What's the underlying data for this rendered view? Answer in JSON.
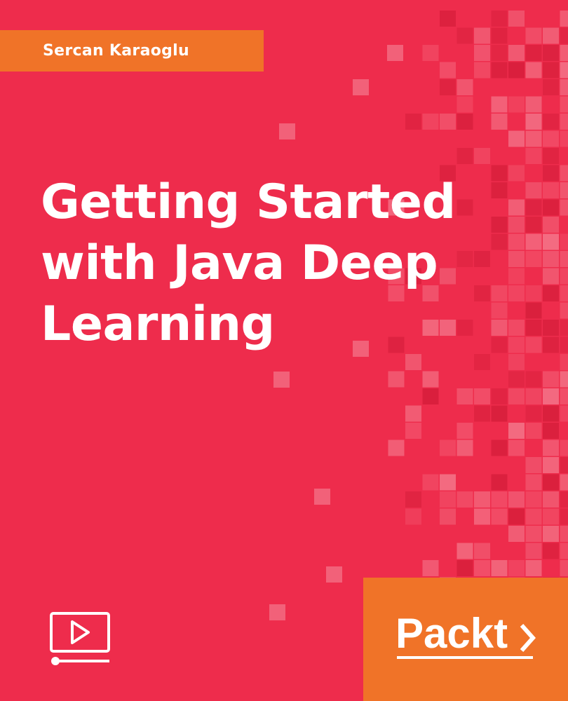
{
  "cover": {
    "author": "Sercan Karaoglu",
    "title_lines": [
      "Getting Started",
      "with Java Deep",
      "Learning"
    ],
    "publisher": "Packt",
    "format_icon": "video-play-icon"
  },
  "colors": {
    "background": "#ee2c4c",
    "accent": "#f07328",
    "text": "#ffffff",
    "pixel_light": "#f36f84",
    "pixel_mid": "#f2506a",
    "pixel_dark": "#d81f3c"
  }
}
